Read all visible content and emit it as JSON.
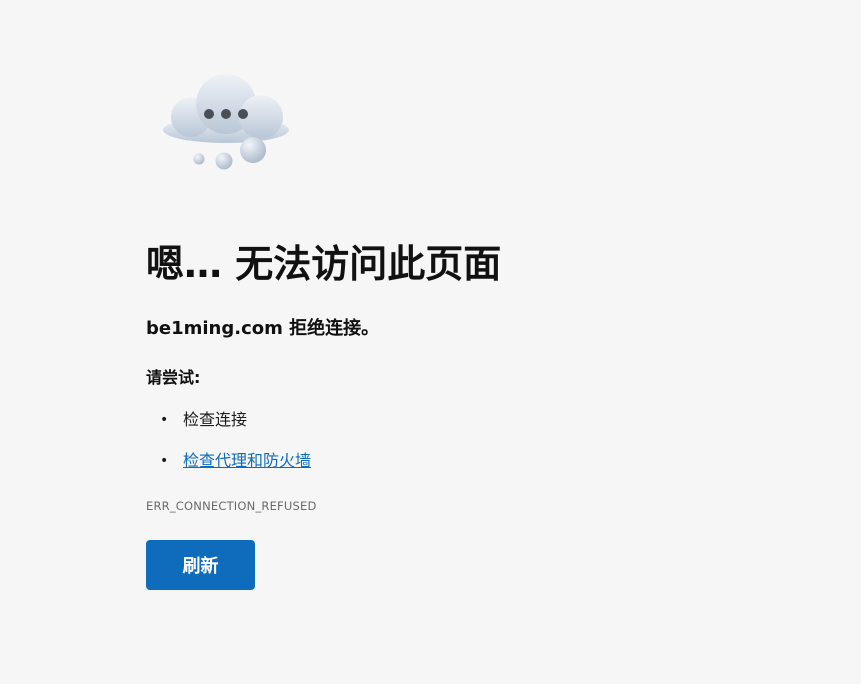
{
  "error_page": {
    "title": "嗯… 无法访问此页面",
    "subtitle": "be1ming.com 拒绝连接。",
    "try_label": "请尝试:",
    "suggestions": [
      {
        "label": "检查连接",
        "is_link": false
      },
      {
        "label": "检查代理和防火墙",
        "is_link": true
      }
    ],
    "bullet": "•",
    "error_code": "ERR_CONNECTION_REFUSED",
    "refresh_label": "刷新",
    "illustration": "cloud-thinking-icon"
  },
  "colors": {
    "background": "#f6f6f6",
    "accent": "#0f6cbd",
    "link": "#0f6cbd",
    "error_code_text": "#6a6a6a"
  }
}
